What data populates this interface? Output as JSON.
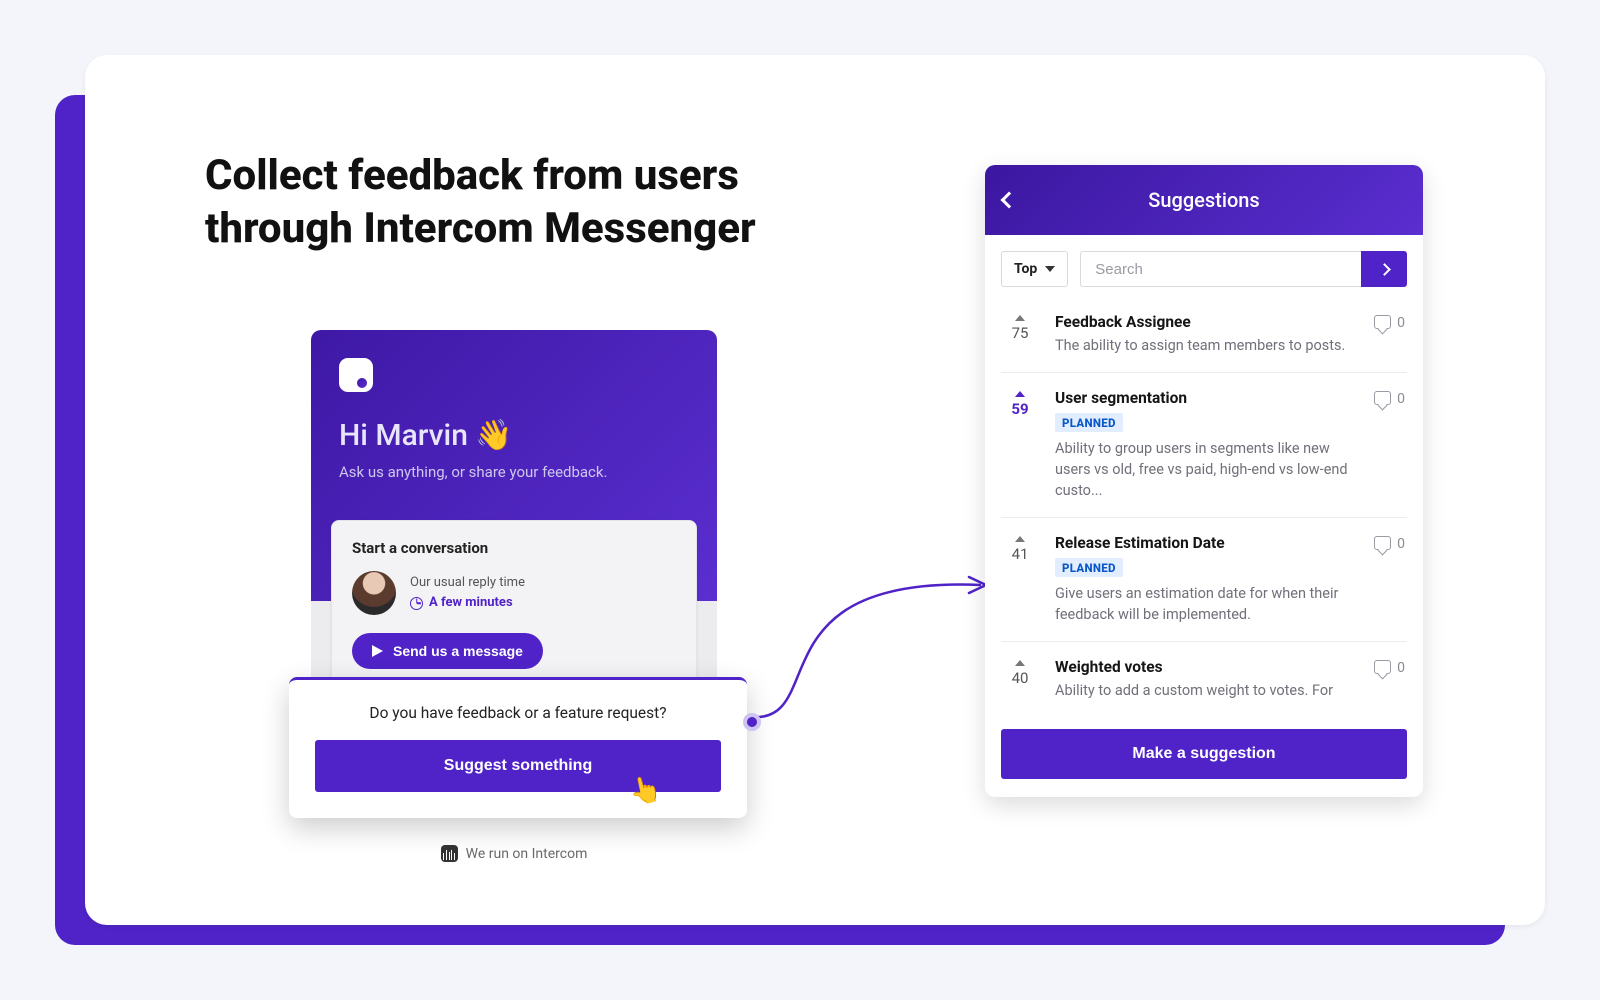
{
  "headline": "Collect feedback from users through Intercom Messenger",
  "messenger": {
    "greeting": "Hi Marvin 👋",
    "subtext": "Ask us anything, or share your feedback.",
    "convo_title": "Start a conversation",
    "reply_label": "Our usual reply time",
    "reply_time": "A few minutes",
    "send_label": "Send us a message"
  },
  "suggest": {
    "question": "Do you have feedback or a feature request?",
    "button": "Suggest something"
  },
  "intercom_foot": "We run on Intercom",
  "panel": {
    "title": "Suggestions",
    "sort_label": "Top",
    "search_placeholder": "Search",
    "make_button": "Make a suggestion",
    "items": [
      {
        "votes": "75",
        "title": "Feedback Assignee",
        "tag": "",
        "desc": "The ability to assign team members to posts.",
        "comments": "0",
        "active": false
      },
      {
        "votes": "59",
        "title": "User segmentation",
        "tag": "PLANNED",
        "desc": "Ability to group users in segments like new users vs old, free vs paid, high-end vs low-end custo...",
        "comments": "0",
        "active": true
      },
      {
        "votes": "41",
        "title": "Release Estimation Date",
        "tag": "PLANNED",
        "desc": "Give users an estimation date for when their feedback will be implemented.",
        "comments": "0",
        "active": false
      },
      {
        "votes": "40",
        "title": "Weighted votes",
        "tag": "",
        "desc": "Ability to add a custom weight to votes. For",
        "comments": "0",
        "active": false
      }
    ]
  }
}
